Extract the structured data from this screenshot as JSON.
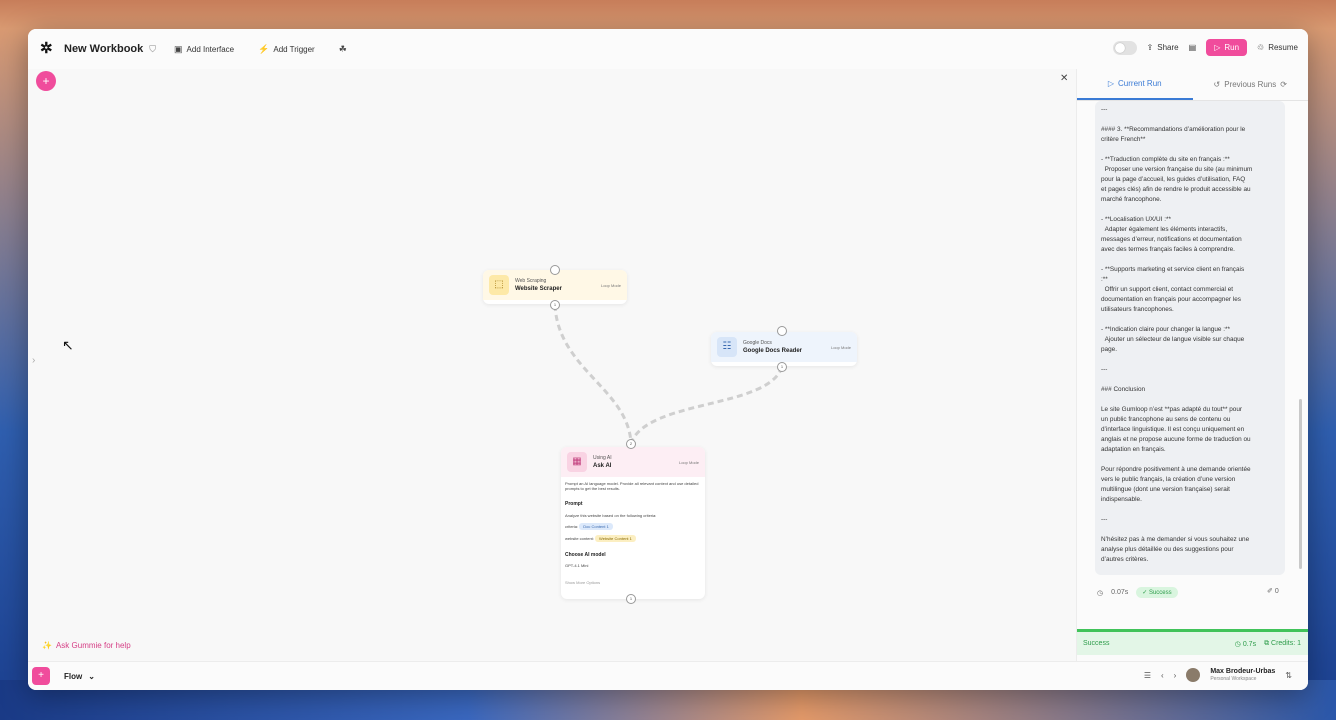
{
  "header": {
    "title": "New Workbook",
    "add_interface": "Add Interface",
    "add_trigger": "Add Trigger",
    "share": "Share",
    "run": "Run",
    "resume": "Resume"
  },
  "canvas": {
    "help": "Ask Gummie for help",
    "nodes": {
      "scraper": {
        "category": "Web Scraping",
        "name": "Website Scraper",
        "mode": "Loop Mode"
      },
      "docs": {
        "category": "Google Docs",
        "name": "Google Docs Reader",
        "mode": "Loop Mode"
      },
      "ai": {
        "category": "Using AI",
        "name": "Ask AI",
        "mode": "Loop Mode",
        "desc": "Prompt an AI language model. Provide all relevant context and use detailed prompts to get the best results.",
        "prompt_label": "Prompt",
        "prompt_line": "Analyze this website based on the following criteria:",
        "criteria_label": "criteria:",
        "criteria_chip": "Doc Content 1",
        "site_label": "website content:",
        "site_chip": "Website Content 1",
        "model_label": "Choose AI model",
        "model_value": "GPT-4.1 Mini",
        "more_options": "Show More Options"
      }
    }
  },
  "bottom": {
    "flow": "Flow",
    "user_name": "Max Brodeur-Urbas",
    "workspace": "Personal Workspace"
  },
  "panel": {
    "tab_current": "Current Run",
    "tab_previous": "Previous Runs",
    "lines": [
      "---",
      "",
      "#### 3. **Recommandations d’amélioration pour le",
      "critère French**",
      "",
      "- **Traduction complète du site en français :**",
      "  Proposer une version française du site (au minimum",
      "pour la page d’accueil, les guides d’utilisation, FAQ",
      "et pages clés) afin de rendre le produit accessible au",
      "marché francophone.",
      "",
      "- **Localisation UX/UI :**",
      "  Adapter également les éléments interactifs,",
      "messages d’erreur, notifications et documentation",
      "avec des termes français faciles à comprendre.",
      "",
      "- **Supports marketing et service client en français",
      ":**",
      "  Offrir un support client, contact commercial et",
      "documentation en français pour accompagner les",
      "utilisateurs francophones.",
      "",
      "- **Indication claire pour changer la langue :**",
      "  Ajouter un sélecteur de langue visible sur chaque",
      "page.",
      "",
      "---",
      "",
      "### Conclusion",
      "",
      "Le site Gumloop n’est **pas adapté du tout** pour",
      "un public francophone au sens de contenu ou",
      "d’interface linguistique. Il est conçu uniquement en",
      "anglais et ne propose aucune forme de traduction ou",
      "adaptation en français.",
      "",
      "Pour répondre positivement à une demande orientée",
      "vers le public français, la création d’une version",
      "multilingue (dont une version française) serait",
      "indispensable.",
      "",
      "---",
      "",
      "N’hésitez pas à me demander si vous souhaitez une",
      "analyse plus détaillée ou des suggestions pour",
      "d’autres critères."
    ],
    "time": "0.07s",
    "success": "Success",
    "attach_count": "0",
    "status": "Success",
    "total_time": "0.7s",
    "credits": "Credits: 1"
  }
}
